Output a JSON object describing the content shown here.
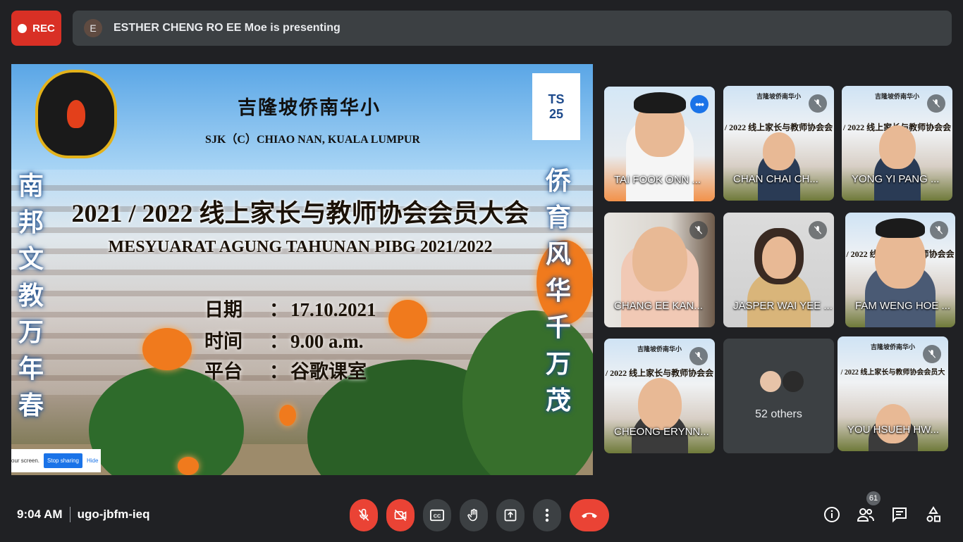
{
  "top": {
    "rec_label": "REC",
    "presenter_initial": "E",
    "presenting_text": "ESTHER CHENG RO EE Moe is presenting"
  },
  "slide": {
    "school_cn": "吉隆坡侨南华小",
    "school_en": "SJK（C）CHIAO NAN, KUALA LUMPUR",
    "heading_cn": "2021 / 2022 线上家长与教师协会会员大会",
    "heading_en": "MESYUARAT AGUNG TAHUNAN PIBG 2021/2022",
    "date_key": "日期",
    "date_val": "17.10.2021",
    "time_key": "时间",
    "time_val": "9.00 a.m.",
    "platform_key": "平台",
    "platform_val": "谷歌课室",
    "colon": "：",
    "left_vertical": [
      "南",
      "邦",
      "文",
      "教",
      "万",
      "年",
      "春"
    ],
    "right_vertical": [
      "侨",
      "育",
      "风",
      "华",
      "千",
      "万",
      "茂"
    ],
    "ts_label": "TS",
    "ts_number": "25",
    "share_text": "our screen.",
    "stop_sharing": "Stop sharing",
    "hide": "Hide"
  },
  "participants": [
    {
      "name": "TAI FOOK ONN ..."
    },
    {
      "name": "CHAN CHAI CH..."
    },
    {
      "name": "YONG YI PANG ..."
    },
    {
      "name": "CHANG EE KAN..."
    },
    {
      "name": "JASPER WAI YEE ..."
    },
    {
      "name": "FAM WENG HOE ..."
    },
    {
      "name": "CHEONG ERYNN..."
    },
    {
      "name": "52 others"
    },
    {
      "name": "YOU HSUEH HW..."
    }
  ],
  "mini_slide": {
    "title": "吉隆坡侨南华小",
    "sub": "SJK（C）CHIAO NAN, KUALA LUMPUR",
    "head": "/ 2022 线上家长与教师协会会员大",
    "head2": "MESYUARAT AGUNG TAHUNAN PIBG 2021/2022"
  },
  "bottom": {
    "time": "9:04 AM",
    "meeting_code": "ugo-jbfm-ieq",
    "people_count": "61"
  },
  "colors": {
    "background": "#202124",
    "panel": "#3c4043",
    "red": "#ea4335",
    "accent_blue": "#8ab4f8"
  }
}
